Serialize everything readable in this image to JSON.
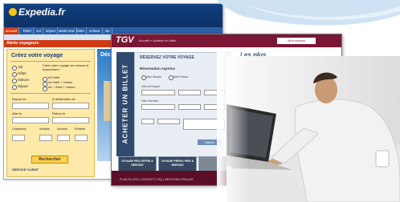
{
  "expedia": {
    "logo": "Expedia.fr",
    "tabs": [
      "accueil",
      "hôtel",
      "vol",
      "séjour",
      "week-end",
      "hôtel",
      "voiture",
      "ski"
    ],
    "alert": "Alerte voyageurs",
    "form": {
      "title": "Créez votre voyage",
      "options": [
        "Vol",
        "Hôtel",
        "Voiture",
        "Séjour"
      ],
      "intro": "Créez votre voyage sur mesure et économisez !",
      "choices": [
        "Vol Hôtel",
        "Vol Hôtel + Voiture",
        "Vol + Hôtel + Voiture"
      ],
      "depart_label": "Départ de",
      "destination_label": "À destination de",
      "aller_label": "Aller le",
      "retour_label": "Retour le",
      "chambres_label": "Chambres",
      "adultes_label": "Adultes",
      "seniors_label": "Seniors",
      "enfants_label": "Enfants",
      "search_label": "Rechercher",
      "service": "SERVICE CLIENT"
    },
    "ad_title": "Décou"
  },
  "tgv": {
    "logo": "TGV",
    "crumb": "Accueil » Acheter un billet",
    "account_label": "Mon espace",
    "side_label": "ACHETER UN BILLET",
    "panel_title": "RÉSERVEZ VOTRE VOYAGE",
    "reservation_label": "Réservation express",
    "aller_simple": "Aller Simple",
    "aller_retour": "Aller-Retour",
    "ville_depart": "Ville de Départ",
    "ville_arrivee": "Ville d'Arrivée",
    "go_label": "Valider",
    "plus": "Les plus",
    "tile_pro": "VOYAGE PRO OFFRE & SERVICE",
    "tile_perso": "VOYAGE PERSO PRIX & SERVICE",
    "footer": "PLAN DU SITE | CONTACT | FAQ | MENTIONS LÉGALES"
  }
}
